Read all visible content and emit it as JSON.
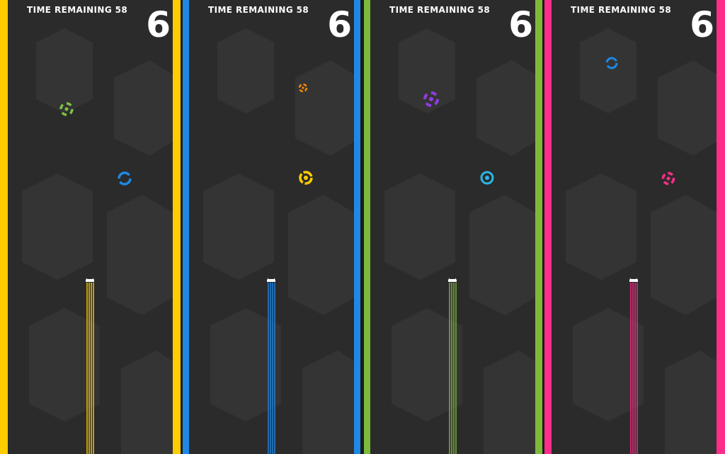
{
  "lanes": [
    {
      "accent": "#ffcc00",
      "timer_label": "TIME REMAINING 58",
      "score": "6",
      "targets": [
        {
          "color": "#7dc242",
          "icon": "dotted-ring-target"
        },
        {
          "color": "#1e88e5",
          "icon": "ring-target"
        }
      ]
    },
    {
      "accent": "#1e88e5",
      "timer_label": "TIME REMAINING 58",
      "score": "6",
      "targets": [
        {
          "color": "#ff8a00",
          "icon": "small-dotted-target"
        },
        {
          "color": "#ffcc00",
          "icon": "bullseye-target"
        }
      ]
    },
    {
      "accent": "#7db93a",
      "timer_label": "TIME REMAINING 58",
      "score": "6",
      "targets": [
        {
          "color": "#8e3de0",
          "icon": "dotted-ring-target"
        },
        {
          "color": "#29b6e8",
          "icon": "bullseye-target"
        }
      ]
    },
    {
      "accent": "#ff2d8a",
      "timer_label": "TIME REMAINING 58",
      "score": "6",
      "targets": [
        {
          "color": "#1e88e5",
          "icon": "ring-target"
        },
        {
          "color": "#ff2d8a",
          "icon": "dotted-ring-target"
        }
      ]
    }
  ]
}
